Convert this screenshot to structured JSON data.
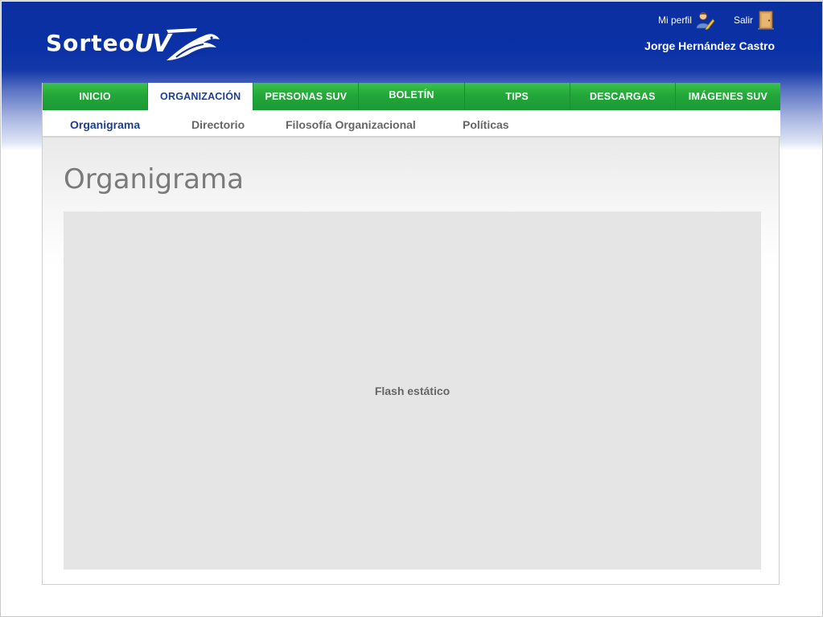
{
  "header": {
    "logo_text": "Sorteo",
    "logo_uv": "UV",
    "user": {
      "profile_label": "Mi perfil",
      "profile_icon": "user-pencil-icon",
      "exit_label": "Salir",
      "exit_icon": "door-icon",
      "name": "Jorge Hernández Castro"
    }
  },
  "main_nav": {
    "tabs": [
      {
        "label": "INICIO",
        "active": false
      },
      {
        "label": "ORGANIZACIÓN",
        "active": true
      },
      {
        "label": "PERSONAS SUV",
        "active": false
      },
      {
        "label": "BOLETÍN",
        "active": false
      },
      {
        "label": "TIPS",
        "active": false
      },
      {
        "label": "DESCARGAS",
        "active": false
      },
      {
        "label": "IMÁGENES SUV",
        "active": false
      }
    ]
  },
  "sub_nav": {
    "items": [
      {
        "label": "Organigrama",
        "active": true
      },
      {
        "label": "Directorio",
        "active": false
      },
      {
        "label": "Filosofía Organizacional",
        "active": false
      },
      {
        "label": "Políticas",
        "active": false
      }
    ]
  },
  "main": {
    "title": "Organigrama",
    "flash_placeholder": "Flash estático"
  },
  "colors": {
    "header_blue": "#0b2fa0",
    "nav_green": "#22a63a",
    "active_text": "#1d3f94",
    "placeholder_gray": "#e5e5e5"
  }
}
